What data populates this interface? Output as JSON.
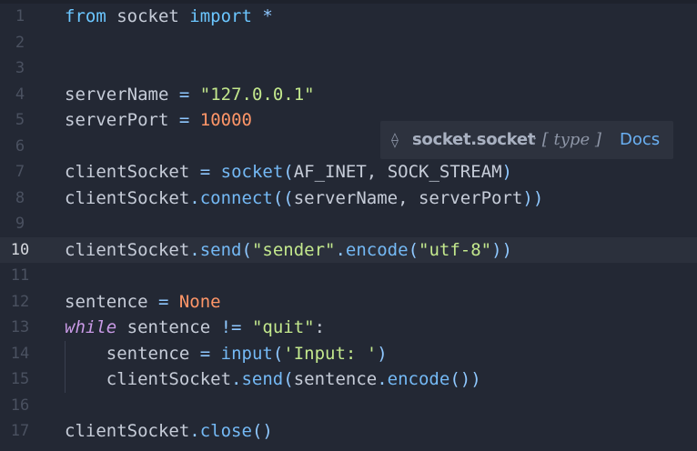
{
  "editor": {
    "active_line": 10,
    "lines": [
      {
        "n": "1",
        "tokens": [
          {
            "t": "from",
            "c": "kw"
          },
          {
            "t": " socket ",
            "c": "txt"
          },
          {
            "t": "import",
            "c": "kw"
          },
          {
            "t": " *",
            "c": "op"
          }
        ]
      },
      {
        "n": "2",
        "tokens": []
      },
      {
        "n": "3",
        "tokens": []
      },
      {
        "n": "4",
        "tokens": [
          {
            "t": "serverName ",
            "c": "txt"
          },
          {
            "t": "=",
            "c": "op"
          },
          {
            "t": " ",
            "c": "txt"
          },
          {
            "t": "\"127.0.0.1\"",
            "c": "str"
          }
        ]
      },
      {
        "n": "5",
        "tokens": [
          {
            "t": "serverPort ",
            "c": "txt"
          },
          {
            "t": "=",
            "c": "op"
          },
          {
            "t": " ",
            "c": "txt"
          },
          {
            "t": "10000",
            "c": "num"
          }
        ]
      },
      {
        "n": "6",
        "tokens": []
      },
      {
        "n": "7",
        "tokens": [
          {
            "t": "clientSocket ",
            "c": "txt"
          },
          {
            "t": "=",
            "c": "op"
          },
          {
            "t": " ",
            "c": "txt"
          },
          {
            "t": "socket",
            "c": "fn"
          },
          {
            "t": "(",
            "c": "op"
          },
          {
            "t": "AF_INET",
            "c": "txt"
          },
          {
            "t": ", ",
            "c": "txt"
          },
          {
            "t": "SOCK_STREAM",
            "c": "txt"
          },
          {
            "t": ")",
            "c": "op"
          }
        ]
      },
      {
        "n": "8",
        "tokens": [
          {
            "t": "clientSocket",
            "c": "txt"
          },
          {
            "t": ".",
            "c": "op"
          },
          {
            "t": "connect",
            "c": "fn"
          },
          {
            "t": "((",
            "c": "op"
          },
          {
            "t": "serverName",
            "c": "txt"
          },
          {
            "t": ", ",
            "c": "txt"
          },
          {
            "t": "serverPort",
            "c": "txt"
          },
          {
            "t": "))",
            "c": "op"
          }
        ]
      },
      {
        "n": "9",
        "tokens": []
      },
      {
        "n": "10",
        "tokens": [
          {
            "t": "clientSocket",
            "c": "txt"
          },
          {
            "t": ".",
            "c": "op"
          },
          {
            "t": "send",
            "c": "fn"
          },
          {
            "t": "(",
            "c": "op"
          },
          {
            "t": "\"sender\"",
            "c": "str"
          },
          {
            "t": ".",
            "c": "op"
          },
          {
            "t": "encode",
            "c": "fn"
          },
          {
            "t": "(",
            "c": "op"
          },
          {
            "t": "\"utf-8\"",
            "c": "str"
          },
          {
            "t": "))",
            "c": "op"
          }
        ]
      },
      {
        "n": "11",
        "tokens": []
      },
      {
        "n": "12",
        "tokens": [
          {
            "t": "sentence ",
            "c": "txt"
          },
          {
            "t": "=",
            "c": "op"
          },
          {
            "t": " ",
            "c": "txt"
          },
          {
            "t": "None",
            "c": "num"
          }
        ]
      },
      {
        "n": "13",
        "tokens": [
          {
            "t": "while",
            "c": "kwi"
          },
          {
            "t": " sentence ",
            "c": "txt"
          },
          {
            "t": "!=",
            "c": "op"
          },
          {
            "t": " ",
            "c": "txt"
          },
          {
            "t": "\"quit\"",
            "c": "str"
          },
          {
            "t": ":",
            "c": "txt"
          }
        ]
      },
      {
        "n": "14",
        "tokens": [
          {
            "t": "    sentence ",
            "c": "txt"
          },
          {
            "t": "=",
            "c": "op"
          },
          {
            "t": " ",
            "c": "txt"
          },
          {
            "t": "input",
            "c": "fn"
          },
          {
            "t": "(",
            "c": "op"
          },
          {
            "t": "'Input: '",
            "c": "str"
          },
          {
            "t": ")",
            "c": "op"
          }
        ]
      },
      {
        "n": "15",
        "tokens": [
          {
            "t": "    clientSocket",
            "c": "txt"
          },
          {
            "t": ".",
            "c": "op"
          },
          {
            "t": "send",
            "c": "fn"
          },
          {
            "t": "(",
            "c": "op"
          },
          {
            "t": "sentence",
            "c": "txt"
          },
          {
            "t": ".",
            "c": "op"
          },
          {
            "t": "encode",
            "c": "fn"
          },
          {
            "t": "())",
            "c": "op"
          }
        ]
      },
      {
        "n": "16",
        "tokens": []
      },
      {
        "n": "17",
        "tokens": [
          {
            "t": "clientSocket",
            "c": "txt"
          },
          {
            "t": ".",
            "c": "op"
          },
          {
            "t": "close",
            "c": "fn"
          },
          {
            "t": "()",
            "c": "op"
          }
        ]
      }
    ]
  },
  "tooltip": {
    "icon": "symbol-variable-icon",
    "icon_glyph": "⟠",
    "name": "socket.socket",
    "type_text": ": [ type ]",
    "docs_label": "Docs"
  },
  "colors": {
    "background": "#232834",
    "active_line": "#2b303c",
    "keyword": "#6bc6ff",
    "string": "#c3e88d",
    "number": "#ff9668",
    "function": "#74b9f5",
    "link": "#6ab0f3"
  }
}
